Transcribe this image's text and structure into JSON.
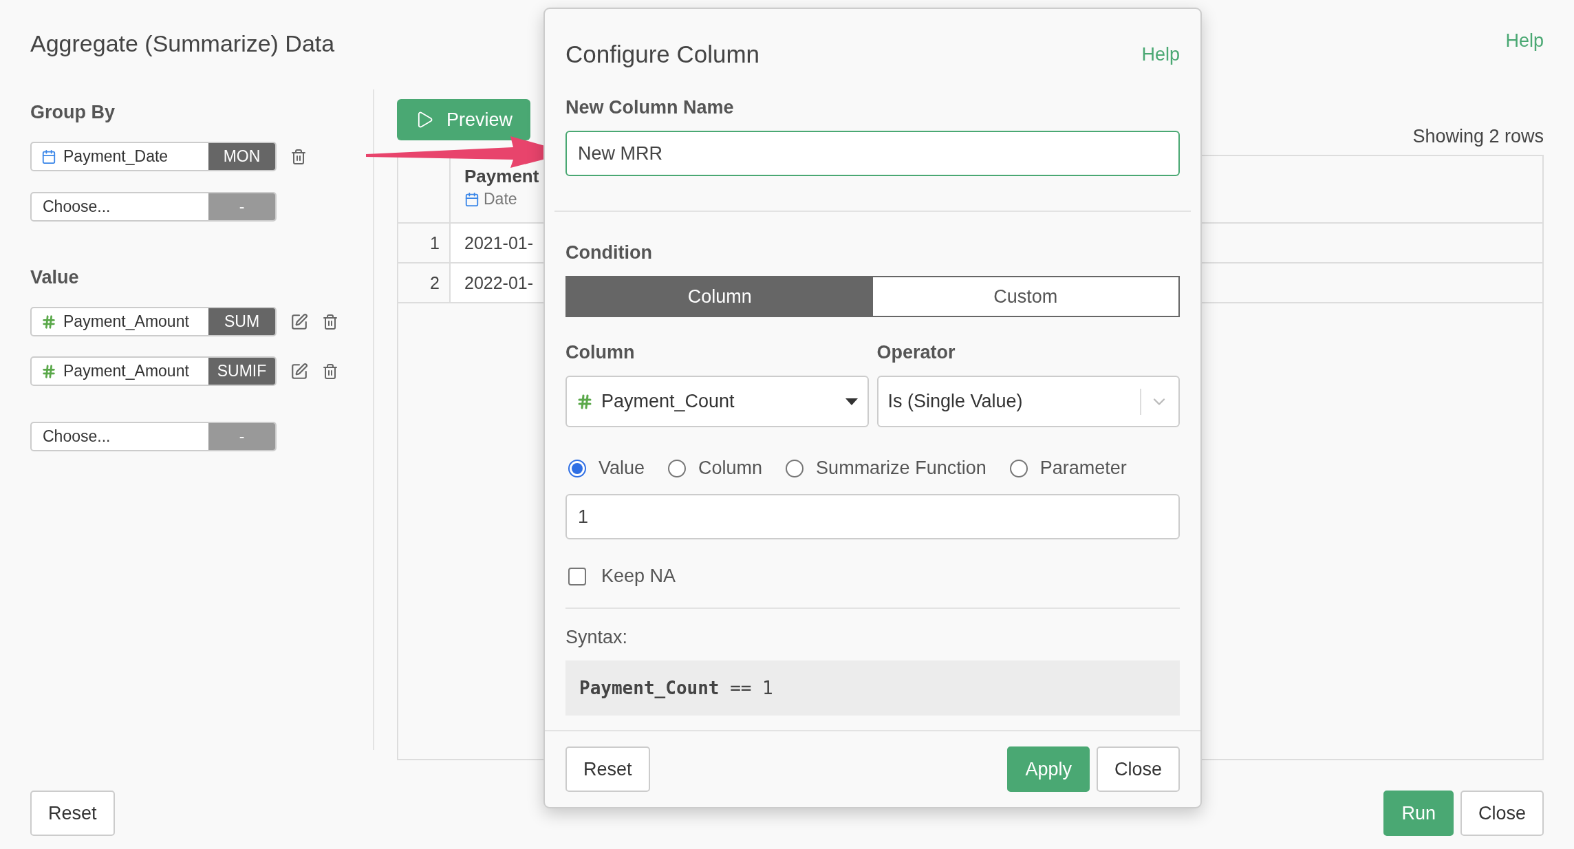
{
  "page": {
    "title": "Aggregate (Summarize) Data",
    "help": "Help"
  },
  "group_by": {
    "label": "Group By",
    "fields": [
      {
        "kind": "date",
        "name": "Payment_Date",
        "function": "MON",
        "editable": false,
        "deletable": true
      },
      {
        "kind": "empty",
        "name": "Choose...",
        "function": "-",
        "editable": false,
        "deletable": false
      }
    ]
  },
  "value": {
    "label": "Value",
    "fields": [
      {
        "kind": "number",
        "name": "Payment_Amount",
        "function": "SUM",
        "editable": true,
        "deletable": true
      },
      {
        "kind": "number",
        "name": "Payment_Amount",
        "function": "SUMIF",
        "editable": true,
        "deletable": true
      },
      {
        "kind": "empty",
        "name": "Choose...",
        "function": "-",
        "editable": false,
        "deletable": false
      }
    ]
  },
  "preview": {
    "button": "Preview",
    "row_count": "Showing 2 rows",
    "columns": [
      {
        "name": "Payment",
        "type": "Date"
      }
    ],
    "rows": [
      {
        "index": "1",
        "cells": [
          "2021-01-"
        ]
      },
      {
        "index": "2",
        "cells": [
          "2022-01-"
        ]
      }
    ]
  },
  "dialog": {
    "title": "Configure Column",
    "help": "Help",
    "name_label": "New Column Name",
    "name_value": "New MRR",
    "condition_label": "Condition",
    "modes": [
      {
        "label": "Column",
        "selected": true
      },
      {
        "label": "Custom",
        "selected": false
      }
    ],
    "column_label": "Column",
    "column_value": {
      "kind": "number",
      "text": "Payment_Count"
    },
    "operator_label": "Operator",
    "operator_value": "Is (Single Value)",
    "value_types": [
      {
        "label": "Value",
        "selected": true
      },
      {
        "label": "Column",
        "selected": false
      },
      {
        "label": "Summarize Function",
        "selected": false
      },
      {
        "label": "Parameter",
        "selected": false
      }
    ],
    "value": "1",
    "keep_na": {
      "label": "Keep NA",
      "checked": false
    },
    "syntax_label": "Syntax:",
    "syntax": "**Payment_Count** == 1",
    "buttons": {
      "reset": "Reset",
      "apply": "Apply",
      "close": "Close"
    }
  },
  "footer": {
    "reset": "Reset",
    "run": "Run",
    "close": "Close"
  }
}
